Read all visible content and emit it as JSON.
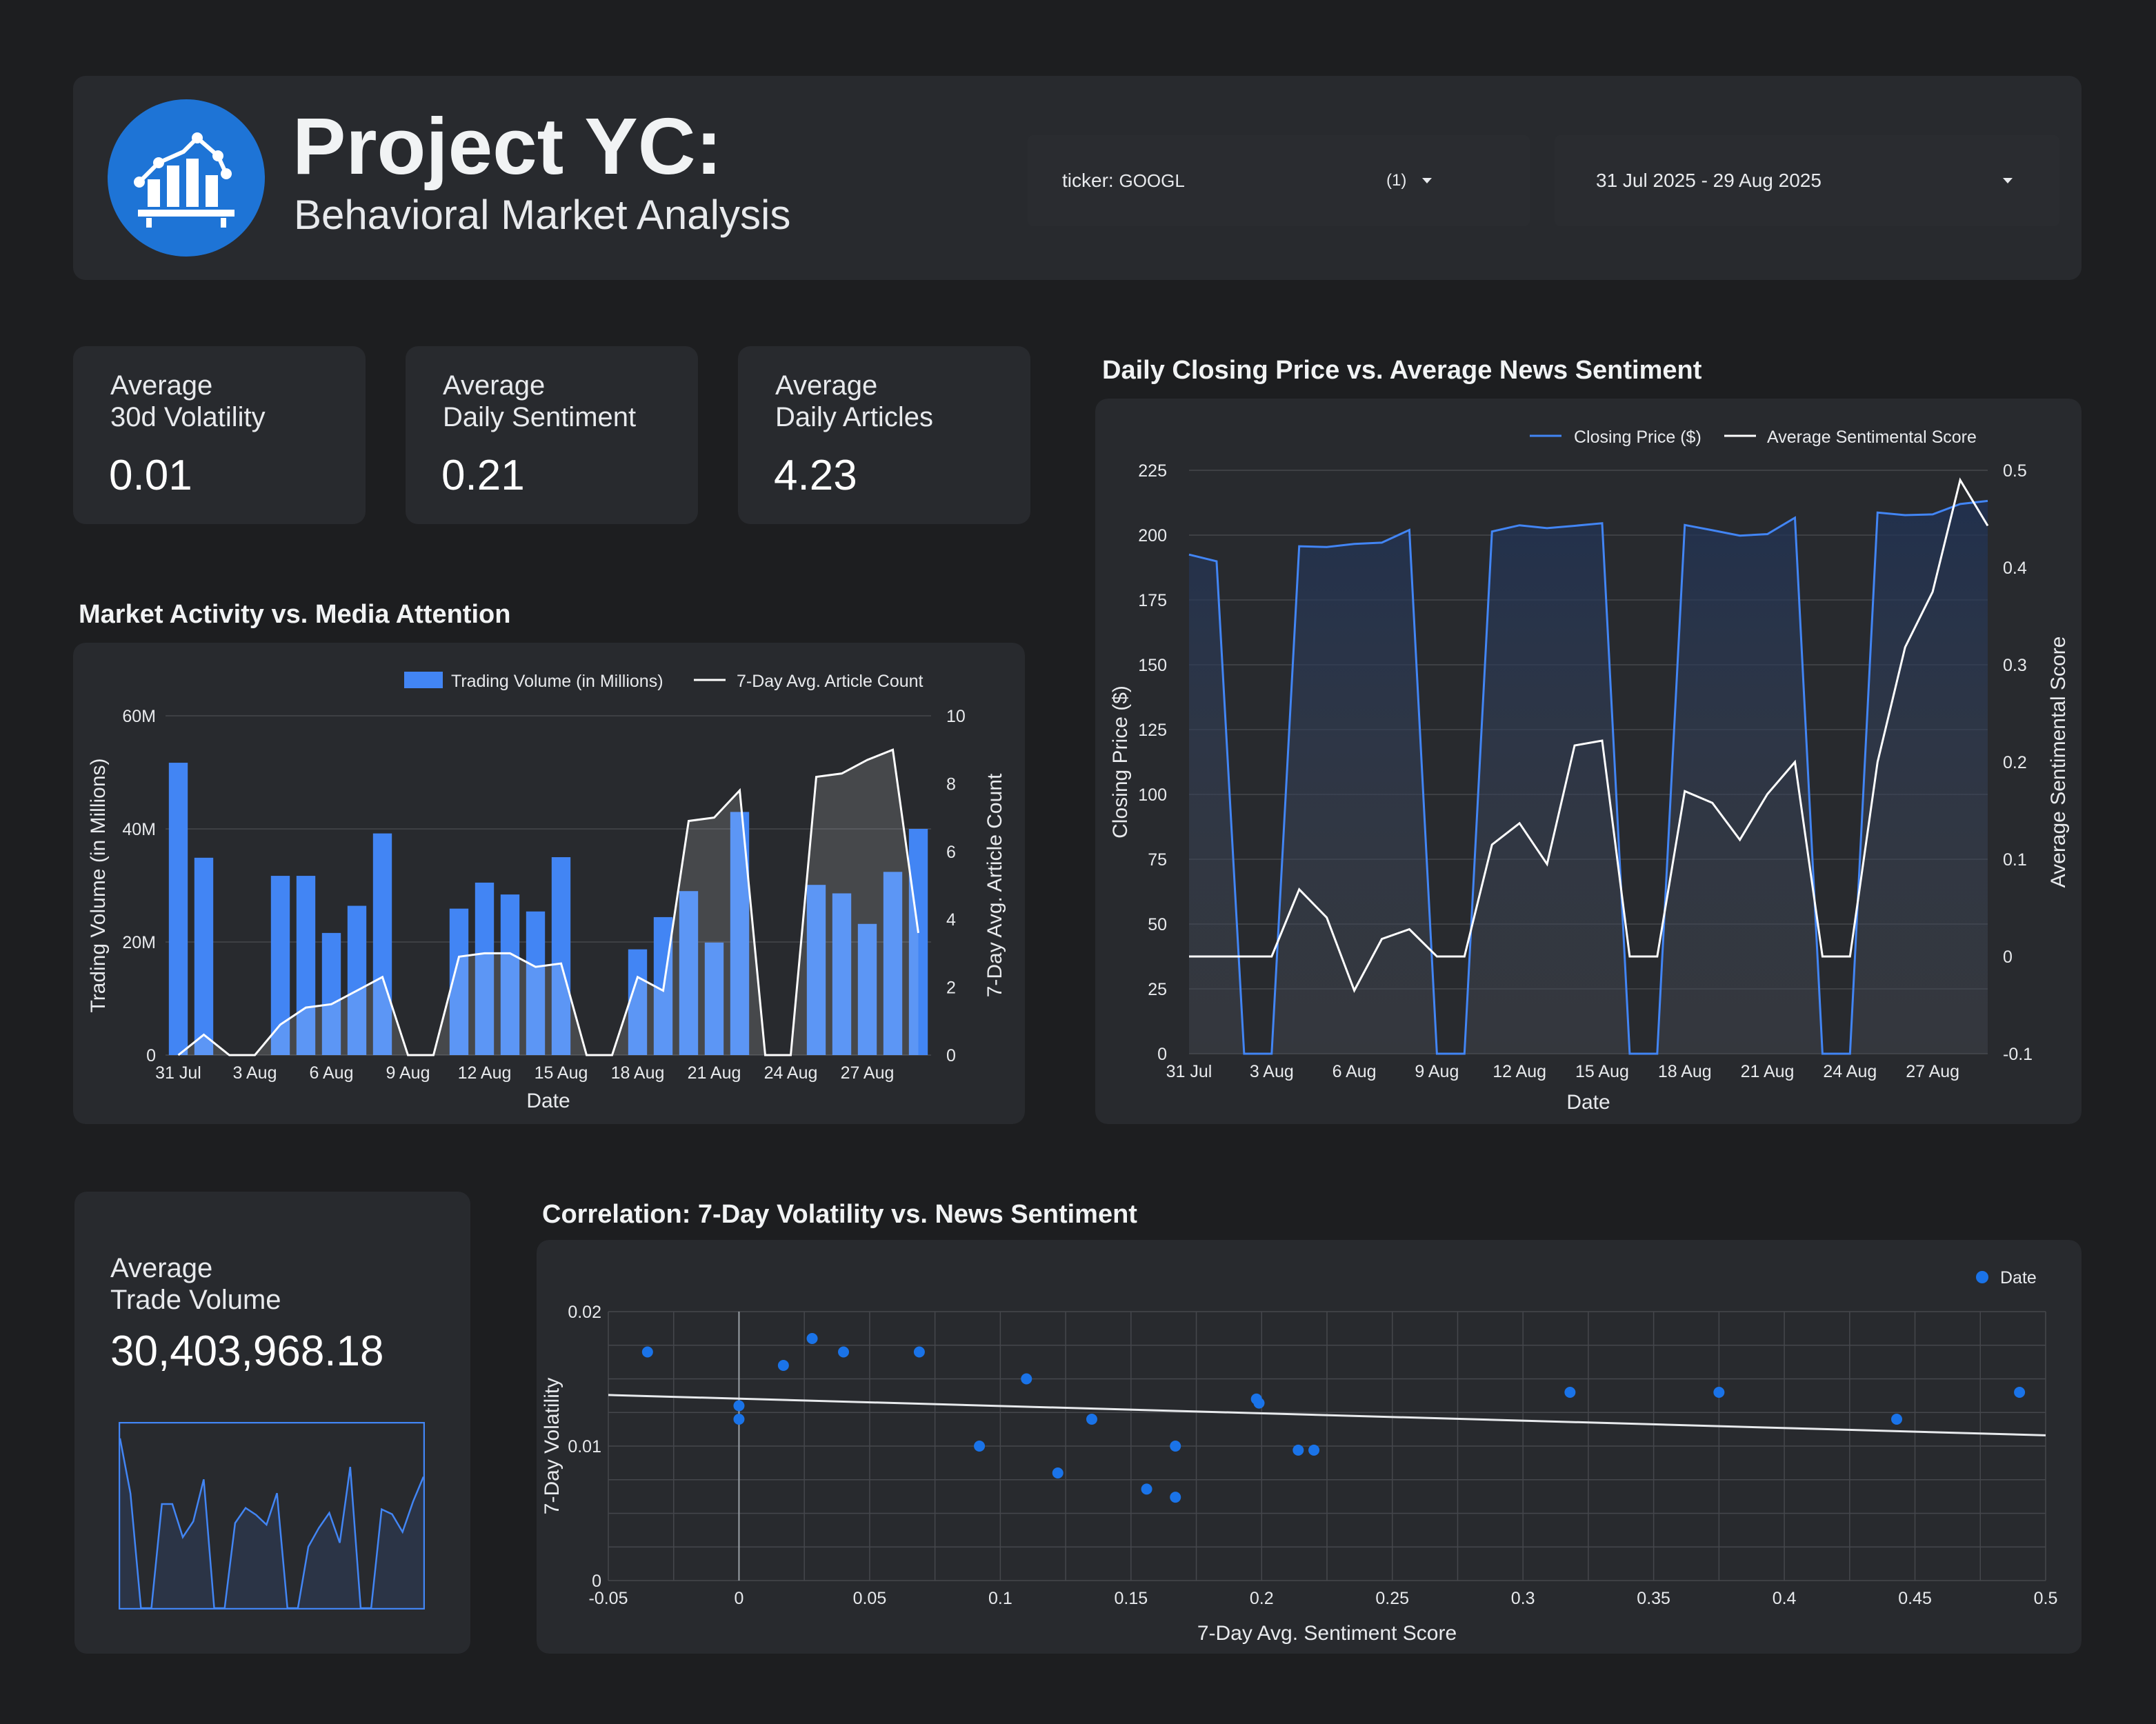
{
  "header": {
    "title": "Project YC:",
    "subtitle": "Behavioral Market Analysis",
    "ticker_label": "ticker:",
    "ticker_value": "GOOGL",
    "ticker_count": "(1)",
    "date_range": "31 Jul 2025 - 29 Aug 2025",
    "logo_icon": "bar-chart-trend-icon"
  },
  "kpis": [
    {
      "label": "Average\n30d Volatility",
      "value": "0.01"
    },
    {
      "label": "Average\nDaily Sentiment",
      "value": "0.21"
    },
    {
      "label": "Average\nDaily Articles",
      "value": "4.23"
    }
  ],
  "trade_volume": {
    "label": "Average\nTrade Volume",
    "value": "30,403,968.18"
  },
  "colors": {
    "background": "#1d1e20",
    "panel": "#282a2e",
    "accent": "#4285f4",
    "line": "#ffffff"
  },
  "chart_data": [
    {
      "type": "bar",
      "title": "Market Activity vs. Media Attention",
      "xlabel": "Date",
      "ylabel": "Trading Volume (in Millions)",
      "y2label": "7-Day Avg. Article Count",
      "ylim": [
        0,
        60
      ],
      "y2lim": [
        0,
        10
      ],
      "yticks": [
        "0",
        "20M",
        "40M",
        "60M"
      ],
      "y2ticks": [
        "0",
        "2",
        "4",
        "6",
        "8",
        "10"
      ],
      "xticks": [
        "31 Jul",
        "3 Aug",
        "6 Aug",
        "9 Aug",
        "12 Aug",
        "15 Aug",
        "18 Aug",
        "21 Aug",
        "24 Aug",
        "27 Aug"
      ],
      "categories": [
        "31 Jul",
        "1 Aug",
        "2 Aug",
        "3 Aug",
        "4 Aug",
        "5 Aug",
        "6 Aug",
        "7 Aug",
        "8 Aug",
        "9 Aug",
        "10 Aug",
        "11 Aug",
        "12 Aug",
        "13 Aug",
        "14 Aug",
        "15 Aug",
        "16 Aug",
        "17 Aug",
        "18 Aug",
        "19 Aug",
        "20 Aug",
        "21 Aug",
        "22 Aug",
        "23 Aug",
        "24 Aug",
        "25 Aug",
        "26 Aug",
        "27 Aug",
        "28 Aug",
        "29 Aug"
      ],
      "series": [
        {
          "name": "Trading Volume (in Millions)",
          "kind": "bar",
          "axis": "left",
          "values": [
            51.7,
            34.9,
            0,
            0,
            31.7,
            31.7,
            21.6,
            26.4,
            39.2,
            0,
            0,
            25.9,
            30.5,
            28.4,
            25.4,
            35.0,
            0,
            0,
            18.7,
            24.4,
            29.0,
            19.9,
            43.0,
            0,
            0,
            30.1,
            28.6,
            23.2,
            32.4,
            40.0
          ]
        },
        {
          "name": "7-Day Avg. Article Count",
          "kind": "line",
          "axis": "right",
          "values": [
            0,
            0.6,
            0,
            0,
            0.9,
            1.4,
            1.5,
            1.9,
            2.3,
            0,
            0,
            2.9,
            3.0,
            3.0,
            2.6,
            2.7,
            0,
            0,
            2.3,
            1.9,
            6.9,
            7.0,
            7.8,
            0,
            0,
            8.2,
            8.3,
            8.7,
            9.0,
            3.6
          ]
        }
      ],
      "legend": "top-right"
    },
    {
      "type": "line",
      "title": "Daily Closing Price vs. Average News Sentiment",
      "xlabel": "Date",
      "ylabel": "Closing Price ($)",
      "y2label": "Average Sentimental Score",
      "ylim": [
        0,
        225
      ],
      "y2lim": [
        -0.1,
        0.5
      ],
      "yticks": [
        "0",
        "25",
        "50",
        "75",
        "100",
        "125",
        "150",
        "175",
        "200",
        "225"
      ],
      "y2ticks": [
        "-0.1",
        "0",
        "0.1",
        "0.2",
        "0.3",
        "0.4",
        "0.5"
      ],
      "xticks": [
        "31 Jul",
        "3 Aug",
        "6 Aug",
        "9 Aug",
        "12 Aug",
        "15 Aug",
        "18 Aug",
        "21 Aug",
        "24 Aug",
        "27 Aug"
      ],
      "categories": [
        "31 Jul",
        "1 Aug",
        "2 Aug",
        "3 Aug",
        "4 Aug",
        "5 Aug",
        "6 Aug",
        "7 Aug",
        "8 Aug",
        "9 Aug",
        "10 Aug",
        "11 Aug",
        "12 Aug",
        "13 Aug",
        "14 Aug",
        "15 Aug",
        "16 Aug",
        "17 Aug",
        "18 Aug",
        "19 Aug",
        "20 Aug",
        "21 Aug",
        "22 Aug",
        "23 Aug",
        "24 Aug",
        "25 Aug",
        "26 Aug",
        "27 Aug",
        "28 Aug",
        "29 Aug"
      ],
      "series": [
        {
          "name": "Closing Price ($)",
          "axis": "left",
          "values": [
            192.5,
            189.9,
            0,
            0,
            195.7,
            195.4,
            196.6,
            197.1,
            202.0,
            0,
            0,
            201.4,
            203.8,
            202.7,
            203.6,
            204.6,
            0,
            0,
            203.9,
            201.9,
            199.8,
            200.4,
            206.7,
            0,
            0,
            208.7,
            207.7,
            208.0,
            212.0,
            213.2
          ]
        },
        {
          "name": "Average Sentimental Score",
          "axis": "right",
          "values": [
            0,
            0,
            0,
            0,
            0.069,
            0.04,
            -0.035,
            0.018,
            0.028,
            0,
            0,
            0.115,
            0.137,
            0.095,
            0.217,
            0.222,
            0,
            0,
            0.17,
            0.158,
            0.12,
            0.167,
            0.2,
            0,
            0,
            0.2,
            0.318,
            0.375,
            0.49,
            0.443
          ]
        }
      ],
      "legend": "top-right"
    },
    {
      "type": "scatter",
      "title": "Correlation: 7-Day Volatility vs. News Sentiment",
      "xlabel": "7-Day Avg. Sentiment Score",
      "ylabel": "7-Day Volatility",
      "xlim": [
        -0.05,
        0.5
      ],
      "ylim": [
        0,
        0.02
      ],
      "xticks": [
        "-0.05",
        "0",
        "0.05",
        "0.1",
        "0.15",
        "0.2",
        "0.25",
        "0.3",
        "0.35",
        "0.4",
        "0.45",
        "0.5"
      ],
      "yticks": [
        "0",
        "0.01",
        "0.02"
      ],
      "series": [
        {
          "name": "Date",
          "points": [
            [
              -0.035,
              0.017
            ],
            [
              0,
              0.013
            ],
            [
              0,
              0.012
            ],
            [
              0.017,
              0.016
            ],
            [
              0.028,
              0.018
            ],
            [
              0.04,
              0.017
            ],
            [
              0.069,
              0.017
            ],
            [
              0.092,
              0.01
            ],
            [
              0.11,
              0.015
            ],
            [
              0.122,
              0.008
            ],
            [
              0.135,
              0.012
            ],
            [
              0.156,
              0.0068
            ],
            [
              0.167,
              0.0062
            ],
            [
              0.167,
              0.01
            ],
            [
              0.198,
              0.0135
            ],
            [
              0.199,
              0.0132
            ],
            [
              0.214,
              0.0097
            ],
            [
              0.22,
              0.0097
            ],
            [
              0.318,
              0.014
            ],
            [
              0.375,
              0.014
            ],
            [
              0.443,
              0.012
            ],
            [
              0.49,
              0.014
            ]
          ]
        }
      ],
      "trendline": {
        "x": [
          -0.05,
          0.5
        ],
        "y": [
          0.0138,
          0.0108
        ]
      },
      "legend": "top-right"
    },
    {
      "type": "area",
      "title": "",
      "series": [
        {
          "name": "",
          "values": [
            51.7,
            34.9,
            0,
            0,
            31.7,
            31.7,
            21.6,
            26.4,
            39.2,
            0,
            0,
            25.9,
            30.5,
            28.4,
            25.4,
            35.0,
            0,
            0,
            18.7,
            24.4,
            29.0,
            19.9,
            43.0,
            0,
            0,
            30.1,
            28.6,
            23.2,
            32.4,
            40.0
          ]
        }
      ],
      "ylim": [
        0,
        55
      ]
    }
  ]
}
